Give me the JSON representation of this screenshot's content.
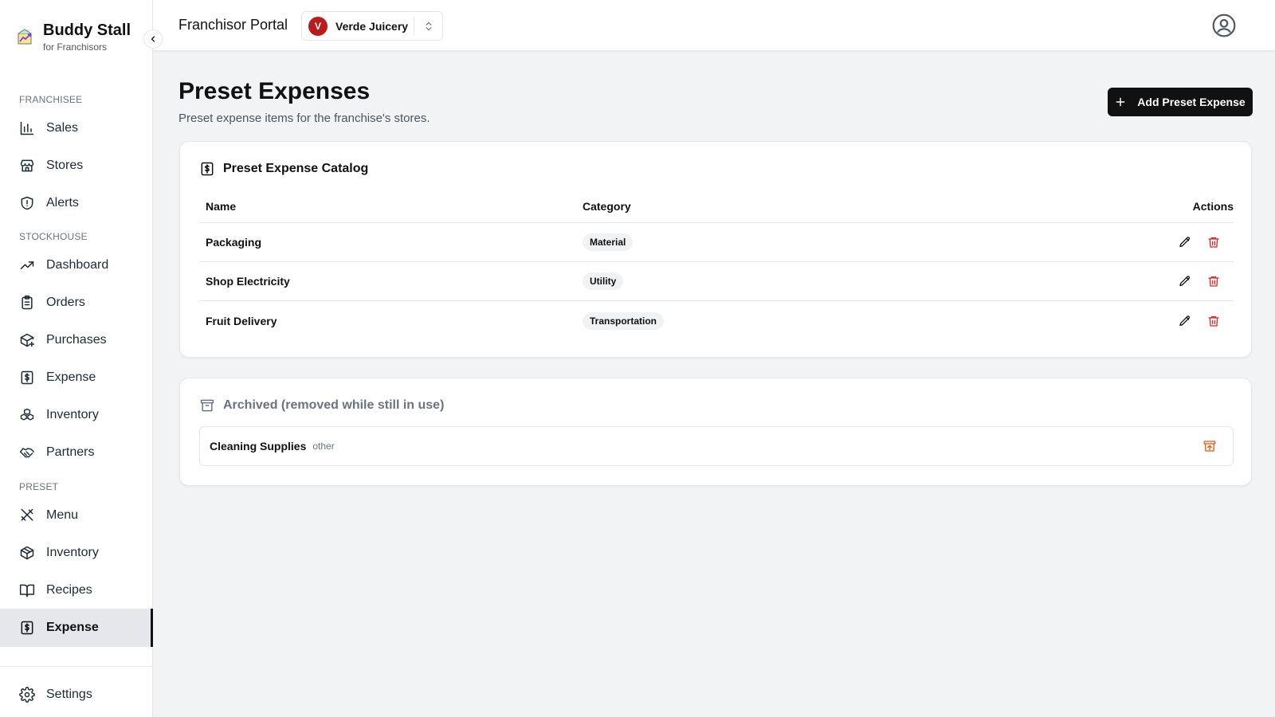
{
  "brand": {
    "title": "Buddy Stall",
    "subtitle": "for Franchisors"
  },
  "sidebar": {
    "sections": [
      {
        "label": "FRANCHISEE"
      },
      {
        "label": "STOCKHOUSE"
      },
      {
        "label": "PRESET"
      }
    ],
    "items": [
      {
        "label": "Sales",
        "icon": "bar-chart-icon"
      },
      {
        "label": "Stores",
        "icon": "store-icon"
      },
      {
        "label": "Alerts",
        "icon": "shield-alert-icon"
      },
      {
        "label": "Dashboard",
        "icon": "trending-up-icon"
      },
      {
        "label": "Orders",
        "icon": "clipboard-icon"
      },
      {
        "label": "Purchases",
        "icon": "package-plus-icon"
      },
      {
        "label": "Expense",
        "icon": "receipt-dollar-icon"
      },
      {
        "label": "Inventory",
        "icon": "boxes-icon"
      },
      {
        "label": "Partners",
        "icon": "handshake-icon"
      },
      {
        "label": "Menu",
        "icon": "utensils-icon"
      },
      {
        "label": "Inventory",
        "icon": "package-icon"
      },
      {
        "label": "Recipes",
        "icon": "book-open-icon"
      },
      {
        "label": "Expense",
        "icon": "receipt-dollar-icon",
        "active": true
      },
      {
        "label": "Settings",
        "icon": "gear-icon"
      }
    ]
  },
  "topbar": {
    "portal_title": "Franchisor Portal",
    "org": {
      "initial": "V",
      "name": "Verde Juicery",
      "avatar_color": "#b91c1c"
    }
  },
  "page": {
    "title": "Preset Expenses",
    "subtitle": "Preset expense items for the franchise's stores.",
    "add_button_label": "Add Preset Expense"
  },
  "catalog": {
    "title": "Preset Expense Catalog",
    "columns": {
      "name": "Name",
      "category": "Category",
      "actions": "Actions"
    },
    "rows": [
      {
        "name": "Packaging",
        "category": "Material"
      },
      {
        "name": "Shop Electricity",
        "category": "Utility"
      },
      {
        "name": "Fruit Delivery",
        "category": "Transportation"
      }
    ]
  },
  "archived": {
    "title": "Archived (removed while still in use)",
    "items": [
      {
        "name": "Cleaning Supplies",
        "category": "other"
      }
    ]
  },
  "colors": {
    "accent": "#111111",
    "danger": "#dc2626",
    "restore": "#ea580c"
  }
}
